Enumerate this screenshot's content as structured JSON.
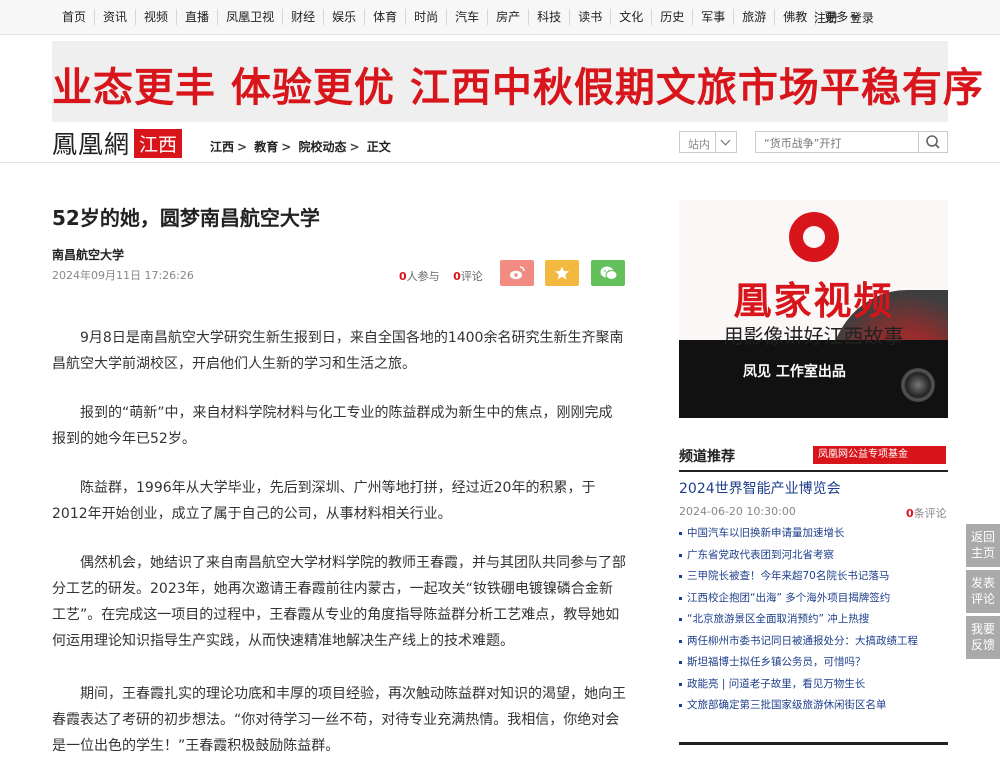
{
  "nav": {
    "items": [
      "首页",
      "资讯",
      "视频",
      "直播",
      "凤凰卫视",
      "财经",
      "娱乐",
      "体育",
      "时尚",
      "汽车",
      "房产",
      "科技",
      "读书",
      "文化",
      "历史",
      "军事",
      "旅游",
      "佛教",
      "更多"
    ],
    "register": "注册",
    "login": "登录"
  },
  "banner": {
    "text": "业态更丰 体验更优 江西中秋假期文旅市场平稳有序"
  },
  "logo": {
    "main": "鳳凰網",
    "region": "江西"
  },
  "breadcrumb": [
    "江西",
    "教育",
    "院校动态",
    "正文"
  ],
  "search": {
    "site_label": "站内",
    "placeholder": "“货币战争”开打"
  },
  "article": {
    "title": "52岁的她，圆梦南昌航空大学",
    "source": "南昌航空大学",
    "date": "2024年09月11日 17:26:26",
    "participants_count": "0",
    "participants_label": "人参与",
    "comments_count": "0",
    "comments_label": "评论",
    "paragraphs": [
      "9月8日是南昌航空大学研究生新生报到日，来自全国各地的1400余名研究生新生齐聚南昌航空大学前湖校区，开启他们人生新的学习和生活之旅。",
      "报到的“萌新”中，来自材料学院材料与化工专业的陈益群成为新生中的焦点，刚刚完成报到的她今年已52岁。",
      "陈益群，1996年从大学毕业，先后到深圳、广州等地打拼，经过近20年的积累，于2012年开始创业，成立了属于自己的公司，从事材料相关行业。",
      "偶然机会，她结识了来自南昌航空大学材料学院的教师王春霞，并与其团队共同参与了部分工艺的研发。2023年，她再次邀请王春霞前往内蒙古，一起攻关“钕铁硼电镀镍磷合金新工艺”。在完成这一项目的过程中，王春霞从专业的角度指导陈益群分析工艺难点，教导她如何运用理论知识指导生产实践，从而快速精准地解决生产线上的技术难题。",
      "期间，王春霞扎实的理论功底和丰厚的项目经验，再次触动陈益群对知识的渴望，她向王春霞表达了考研的初步想法。“你对待学习一丝不苟，对待专业充满热情。我相信，你绝对会是一位出色的学生！”王春霞积极鼓励陈益群。"
    ]
  },
  "ad": {
    "headline": "凰家视频",
    "slogan": "用影像讲好江西故事",
    "footer": "凤见 工作室出品"
  },
  "sidebar": {
    "section_title": "频道推荐",
    "fund_label": "凤凰网公益专项基金",
    "head_news": "2024世界智能产业博览会",
    "head_date": "2024-06-20 10:30:00",
    "head_comments_count": "0",
    "head_comments_label": "条评论",
    "news": [
      "中国汽车以旧换新申请量加速增长",
      "广东省党政代表团到河北省考察",
      "三甲院长被查！今年来超70名院长书记落马",
      "江西校企抱团“出海” 多个海外项目揭牌签约",
      "“北京旅游景区全面取消预约” 冲上热搜",
      "两任柳州市委书记同日被通报处分：大搞政绩工程",
      "斯坦福博士拟任乡镇公务员，可惜吗？",
      "政能亮 | 问道老子故里，看见万物生长",
      "文旅部确定第三批国家级旅游休闲街区名单"
    ]
  },
  "float": {
    "home": "返回主页",
    "comment": "发表评论",
    "feedback": "我要反馈"
  },
  "colors": {
    "brand_red": "#d7151b",
    "link_blue": "#1e3f8c"
  }
}
